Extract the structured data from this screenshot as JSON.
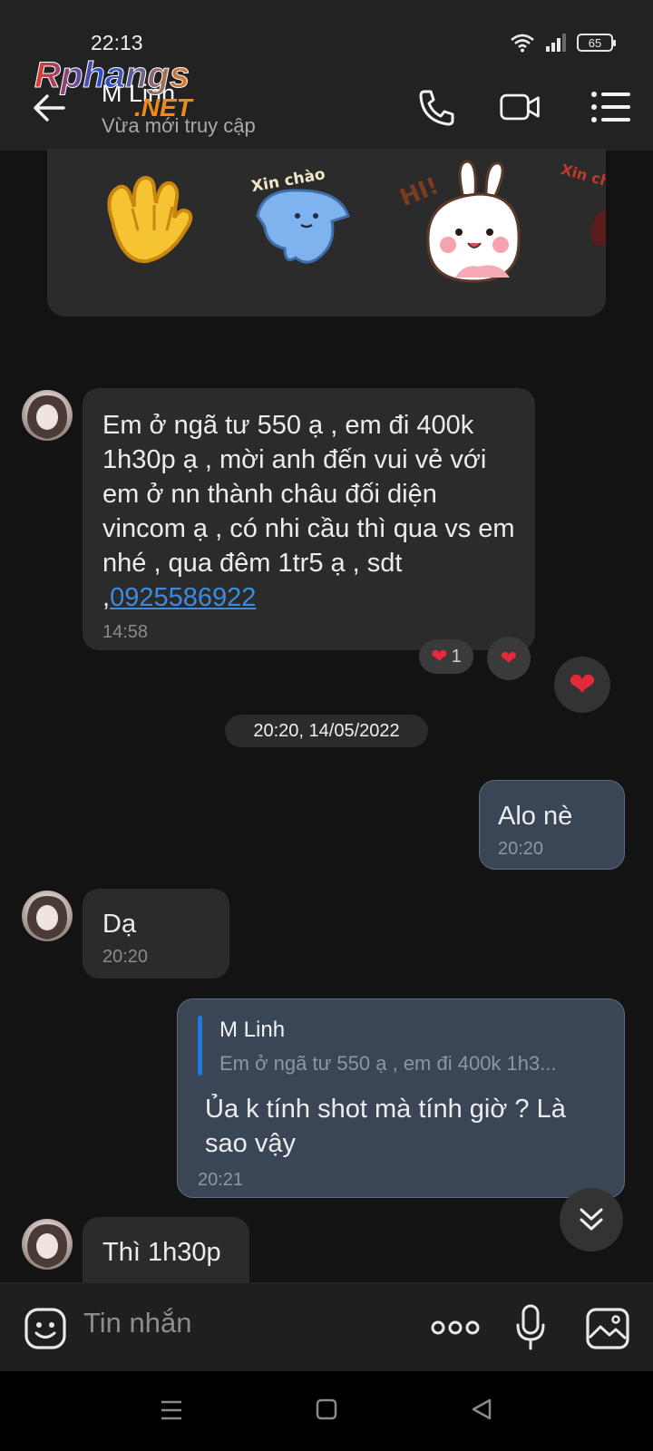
{
  "status_bar": {
    "time": "22:13",
    "battery": "65"
  },
  "header": {
    "contact_name": "M Linh",
    "contact_status": "Vừa mới truy cập",
    "watermark": {
      "top": "Rphangs",
      "bottom": ".NET"
    }
  },
  "stickers": [
    {
      "name": "waving-hand",
      "caption": ""
    },
    {
      "name": "blue-cat",
      "caption": "Xin chào"
    },
    {
      "name": "bunny-hi",
      "caption": "HI!"
    },
    {
      "name": "partial-sticker",
      "caption": "Xin chà"
    }
  ],
  "messages": {
    "m1": {
      "text": "Em ở ngã tư 550 ạ , em đi 400k 1h30p ạ , mời anh đến vui vẻ với em ở nn thành châu đối diện vincom ạ , có nhi cầu thì qua vs em nhé , qua đêm 1tr5 ạ , sdt ,",
      "phone": "0925586922",
      "time": "14:58",
      "reaction_count": "1"
    },
    "date_separator": "20:20, 14/05/2022",
    "m2": {
      "text": "Alo nè",
      "time": "20:20"
    },
    "m3": {
      "text": "Dạ",
      "time": "20:20"
    },
    "m4": {
      "quote_name": "M Linh",
      "quote_text": "Em ở ngã tư 550 ạ , em đi 400k 1h3...",
      "text": "Ủa k tính shot mà tính giờ ? Là sao vậy",
      "time": "20:21"
    },
    "m5": {
      "text": "Thì 1h30p"
    }
  },
  "composer": {
    "placeholder": "Tin nhắn"
  },
  "colors": {
    "background": "#131313",
    "incoming_bubble": "#2b2b2b",
    "outgoing_bubble": "#3a4555",
    "link": "#3d8bdf",
    "quote_bar": "#1f7ae0",
    "heart": "#e5283a"
  }
}
